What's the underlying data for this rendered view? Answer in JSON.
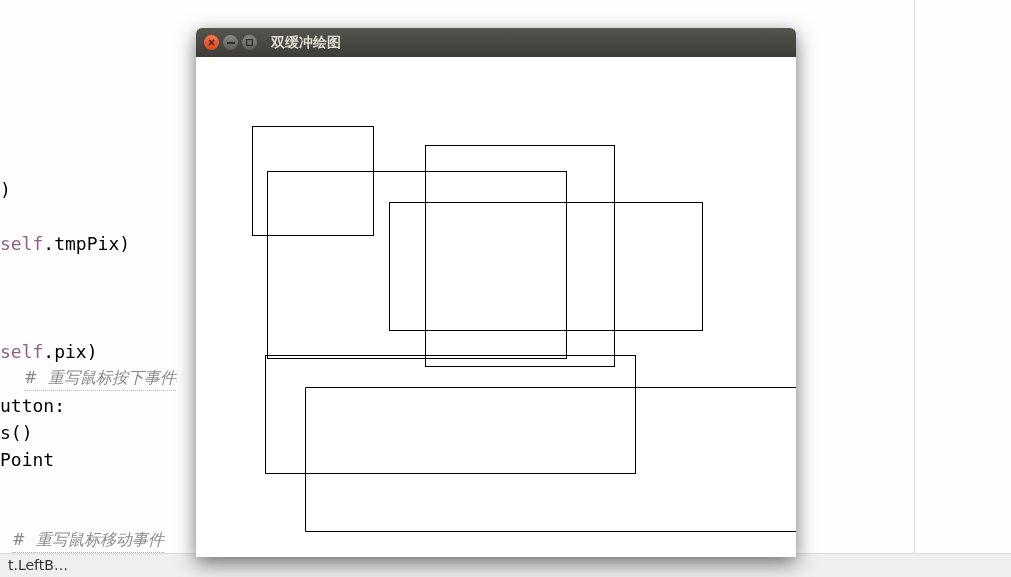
{
  "editor": {
    "lines": [
      {
        "kind": "code",
        "text": ")"
      },
      {
        "kind": "code",
        "prefix": "self",
        "text": ".tmpPix)"
      },
      {
        "kind": "code",
        "prefix": "self",
        "text": ".pix)"
      },
      {
        "kind": "comment",
        "text": "#  重写鼠标按下事件"
      },
      {
        "kind": "code",
        "text": "utton:"
      },
      {
        "kind": "code",
        "text": "s()"
      },
      {
        "kind": "code",
        "text": "Point"
      },
      {
        "kind": "comment",
        "text": "#  重写鼠标移动事件"
      }
    ]
  },
  "status_bar": {
    "text": "t.LeftB…"
  },
  "window": {
    "title": "双缓冲绘图"
  }
}
